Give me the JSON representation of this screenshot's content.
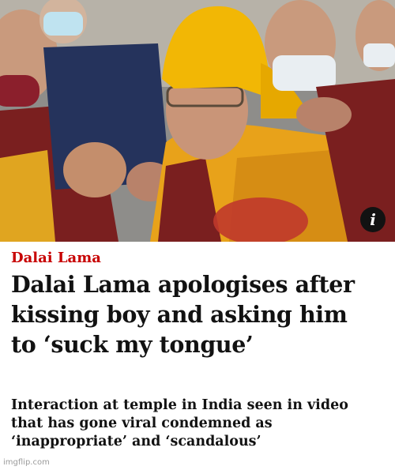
{
  "article": {
    "kicker": "Dalai Lama",
    "headline_lines": [
      "Dalai Lama apologises after",
      "kissing boy and asking him",
      "to ‘suck my tongue’"
    ],
    "standfirst_lines": [
      "Interaction at temple in India seen in video",
      "that has gone viral condemned as",
      "‘inappropriate’ and ‘scandalous’"
    ]
  },
  "hero_image": {
    "info_badge": "i",
    "icon": "info-icon"
  },
  "watermark": "imgflip.com",
  "colors": {
    "kicker": "#c70000",
    "text": "#121212",
    "robe_orange": "#e8a21a",
    "hat_yellow": "#f2b705",
    "robe_maroon": "#7a1f1f"
  }
}
